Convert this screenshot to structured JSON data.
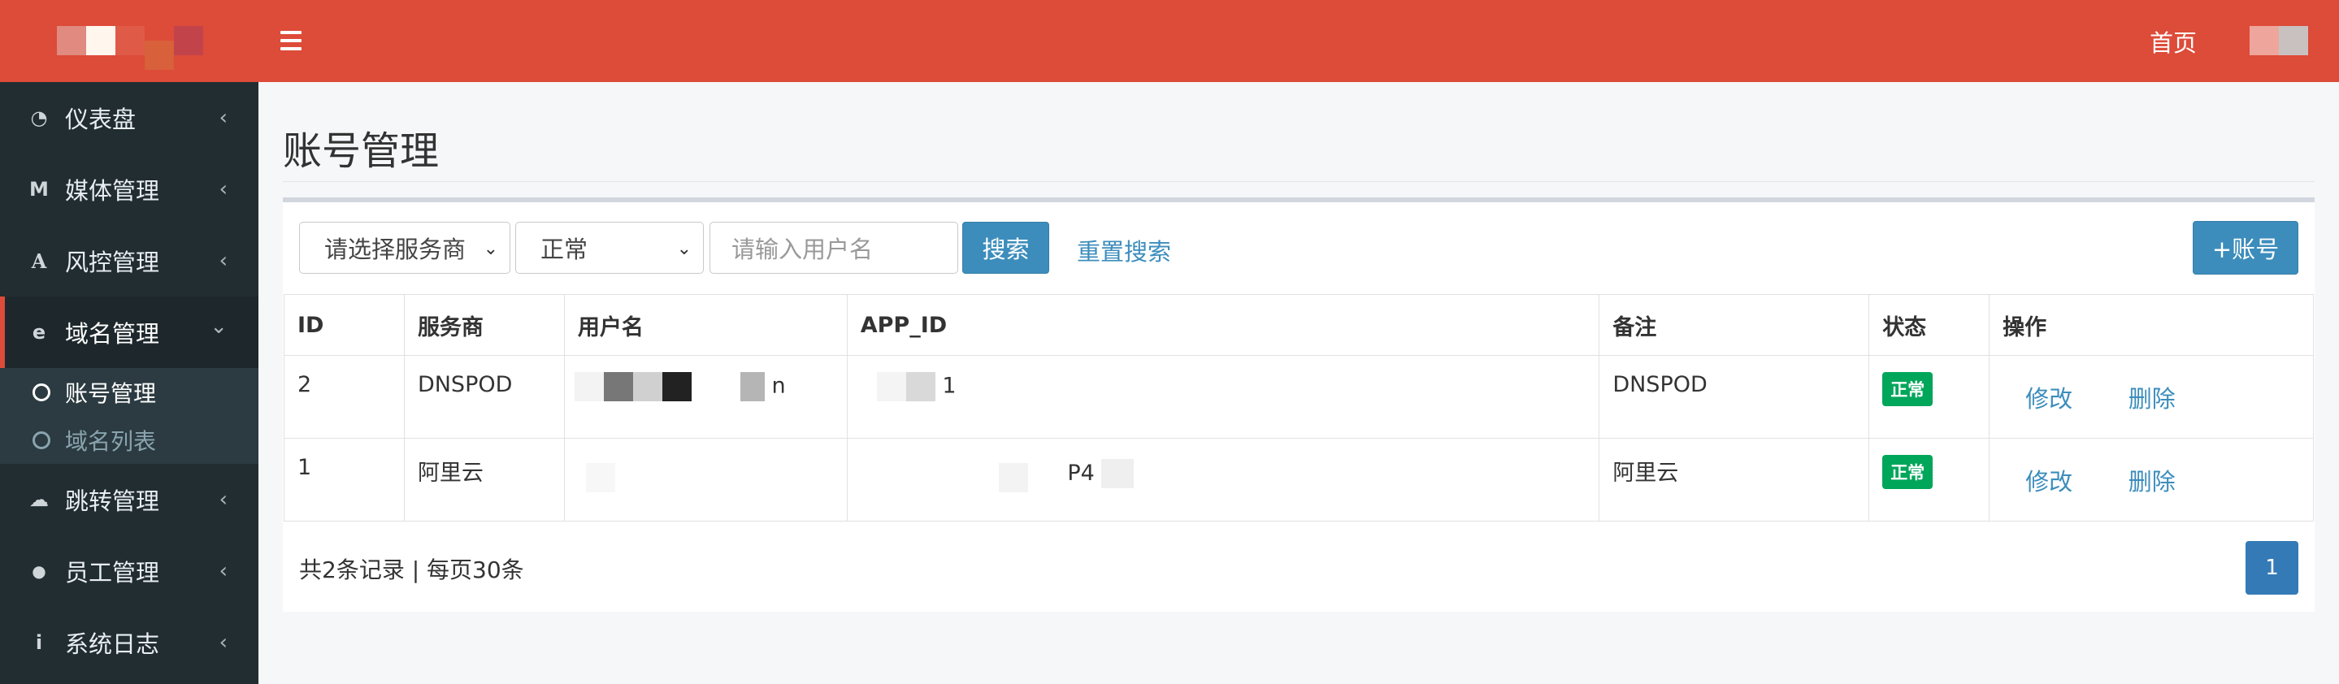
{
  "sidebar": {
    "items": [
      {
        "label": "仪表盘",
        "icon": "dashboard-icon",
        "glyph": "◔"
      },
      {
        "label": "媒体管理",
        "icon": "media-icon",
        "glyph": "M"
      },
      {
        "label": "风控管理",
        "icon": "font-icon",
        "glyph": "A"
      },
      {
        "label": "域名管理",
        "icon": "ie-icon",
        "glyph": "e"
      },
      {
        "label": "跳转管理",
        "icon": "cloud-icon",
        "glyph": "☁"
      },
      {
        "label": "员工管理",
        "icon": "user-icon",
        "glyph": "●"
      },
      {
        "label": "系统日志",
        "icon": "info-icon",
        "glyph": "i"
      }
    ],
    "subitems": [
      {
        "label": "账号管理"
      },
      {
        "label": "域名列表"
      }
    ],
    "chevron_left": "‹",
    "chevron_down": "⌄"
  },
  "topbar": {
    "home": "首页"
  },
  "page": {
    "title": "账号管理"
  },
  "filters": {
    "provider_select": "请选择服务商",
    "status_select": "正常",
    "username_placeholder": "请输入用户名",
    "search_button": "搜索",
    "reset_link": "重置搜索",
    "add_button": "+账号"
  },
  "table": {
    "headers": [
      "ID",
      "服务商",
      "用户名",
      "APP_ID",
      "备注",
      "状态",
      "操作"
    ],
    "rows": [
      {
        "id": "2",
        "provider": "DNSPOD",
        "username": "n",
        "app_id": "1",
        "remark": "DNSPOD",
        "status": "正常",
        "edit": "修改",
        "delete": "删除"
      },
      {
        "id": "1",
        "provider": "阿里云",
        "username": "",
        "app_id": "P4",
        "remark": "阿里云",
        "status": "正常",
        "edit": "修改",
        "delete": "删除"
      }
    ]
  },
  "footer": {
    "summary": "共2条记录 | 每页30条",
    "page": "1"
  },
  "colors": {
    "brand_red": "#dd4b39",
    "sidebar_bg": "#222d32",
    "primary_blue": "#3c8dbc",
    "success_green": "#00a65a"
  }
}
